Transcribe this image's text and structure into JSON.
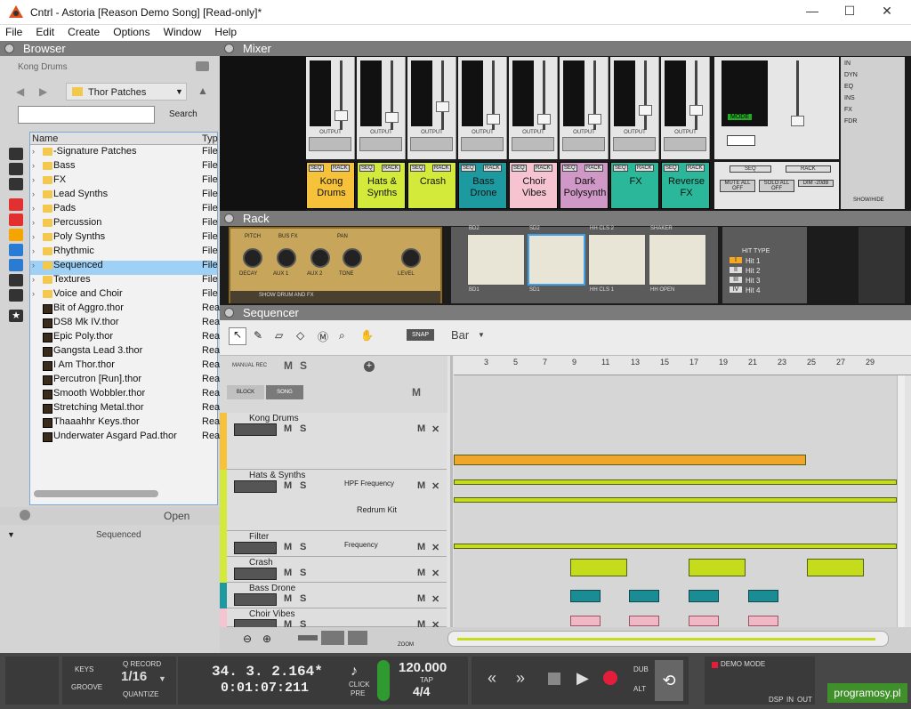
{
  "window": {
    "title": "Cntrl - Astoria [Reason Demo Song] [Read-only]*",
    "minimize": "—",
    "maximize": "☐",
    "close": "✕"
  },
  "menu": [
    "File",
    "Edit",
    "Create",
    "Options",
    "Window",
    "Help"
  ],
  "browser": {
    "title": "Browser",
    "location": "Kong Drums",
    "folder": "Thor Patches",
    "search_label": "Search",
    "search_value": "",
    "col_name": "Name",
    "col_type": "Typ",
    "rows": [
      {
        "name": "-Signature Patches",
        "type": "File"
      },
      {
        "name": "Bass",
        "type": "File"
      },
      {
        "name": "FX",
        "type": "File"
      },
      {
        "name": "Lead Synths",
        "type": "File"
      },
      {
        "name": "Pads",
        "type": "File"
      },
      {
        "name": "Percussion",
        "type": "File"
      },
      {
        "name": "Poly Synths",
        "type": "File"
      },
      {
        "name": "Rhythmic",
        "type": "File"
      },
      {
        "name": "Sequenced",
        "type": "File"
      },
      {
        "name": "Textures",
        "type": "File"
      },
      {
        "name": "Voice and Choir",
        "type": "File"
      },
      {
        "name": "Bit of Aggro.thor",
        "type": "Rea"
      },
      {
        "name": "DS8 Mk IV.thor",
        "type": "Rea"
      },
      {
        "name": "Epic Poly.thor",
        "type": "Rea"
      },
      {
        "name": "Gangsta Lead 3.thor",
        "type": "Rea"
      },
      {
        "name": "I Am Thor.thor",
        "type": "Rea"
      },
      {
        "name": "Percutron [Run].thor",
        "type": "Rea"
      },
      {
        "name": "Smooth Wobbler.thor",
        "type": "Rea"
      },
      {
        "name": "Stretching Metal.thor",
        "type": "Rea"
      },
      {
        "name": "Thaaahhr Keys.thor",
        "type": "Rea"
      },
      {
        "name": "Underwater Asgard Pad.thor",
        "type": "Rea"
      }
    ],
    "open_label": "Open",
    "selected_label": "Sequenced"
  },
  "mixer": {
    "title": "Mixer",
    "channels": [
      {
        "name": "Kong Drums",
        "color": "#f5c23a"
      },
      {
        "name": "Hats & Synths",
        "color": "#d3ea3b"
      },
      {
        "name": "Crash",
        "color": "#d3ea3b"
      },
      {
        "name": "Bass Drone",
        "color": "#1c9aa0"
      },
      {
        "name": "Choir Vibes",
        "color": "#f6c4d0"
      },
      {
        "name": "Dark Polysynth",
        "color": "#cf98c6"
      },
      {
        "name": "FX",
        "color": "#2bb89a"
      },
      {
        "name": "Reverse FX",
        "color": "#2bb89a"
      }
    ],
    "seq_label": "SEQ",
    "rack_label": "RACK",
    "output_label": "OUTPUT",
    "master": {
      "mode": "MODE",
      "mute_all": "MUTE ALL OFF",
      "solo_all": "SOLO ALL OFF",
      "dim": "DIM -20dB",
      "show_hide": "SHOW/HIDE"
    },
    "fx_items": [
      "IN",
      "DYN",
      "EQ",
      "INS",
      "FX",
      "FDR"
    ]
  },
  "rack": {
    "title": "Rack",
    "knobs": [
      "DECAY",
      "AUX 1",
      "AUX 2",
      "TONE",
      "LEVEL"
    ],
    "top_labels": [
      "PITCH",
      "BUS FX",
      "PAN"
    ],
    "show_drum": "SHOW DRUM AND FX",
    "pads": [
      {
        "top": "BD2",
        "bottom": "BD1",
        "n": "1"
      },
      {
        "top": "SD2",
        "bottom": "SD1",
        "n": "2"
      },
      {
        "top": "HH CLS 2",
        "bottom": "HH CLS 1",
        "n": "3"
      },
      {
        "top": "SHAKER",
        "bottom": "HH OPEN",
        "n": "4"
      }
    ],
    "hit_type": "HIT TYPE",
    "hits": [
      {
        "r": "I",
        "name": "Hit 1"
      },
      {
        "r": "II",
        "name": "Hit 2"
      },
      {
        "r": "III",
        "name": "Hit 3"
      },
      {
        "r": "IV",
        "name": "Hit 4"
      }
    ]
  },
  "sequencer": {
    "title": "Sequencer",
    "snap": "SNAP",
    "snap_value": "Bar",
    "manual_rec": "MANUAL REC",
    "block": "BLOCK",
    "song": "SONG",
    "ruler": [
      "3",
      "5",
      "7",
      "9",
      "11",
      "13",
      "15",
      "17",
      "19",
      "21",
      "23",
      "25",
      "27",
      "29"
    ],
    "tracks": [
      {
        "name": "Kong Drums",
        "color": "#f5c23a"
      },
      {
        "name": "Hats & Synths",
        "color": "#d3ea3b",
        "automation": "HPF Frequency",
        "device": "Redrum Kit"
      },
      {
        "name": "Filter",
        "color": "#d3ea3b",
        "automation": "Frequency"
      },
      {
        "name": "Crash",
        "color": "#d3ea3b"
      },
      {
        "name": "Bass Drone",
        "color": "#1c9aa0"
      },
      {
        "name": "Choir Vibes",
        "color": "#f6c4d0"
      }
    ],
    "zoom_label": "ZOOM"
  },
  "transport": {
    "keys": "KEYS",
    "groove": "GROOVE",
    "q_record": "Q RECORD",
    "quantize_value": "1/16",
    "quantize": "QUANTIZE",
    "position": "34. 3. 2.164*",
    "time": "0:01:07:211",
    "click": "CLICK",
    "pre": "PRE",
    "tempo": "120.000",
    "tap": "TAP",
    "signature": "4/4",
    "dub": "DUB",
    "alt": "ALT",
    "demo_mode": "DEMO MODE",
    "dsp": "DSP",
    "in": "IN",
    "out": "OUT"
  },
  "watermark": "programosy.pl"
}
